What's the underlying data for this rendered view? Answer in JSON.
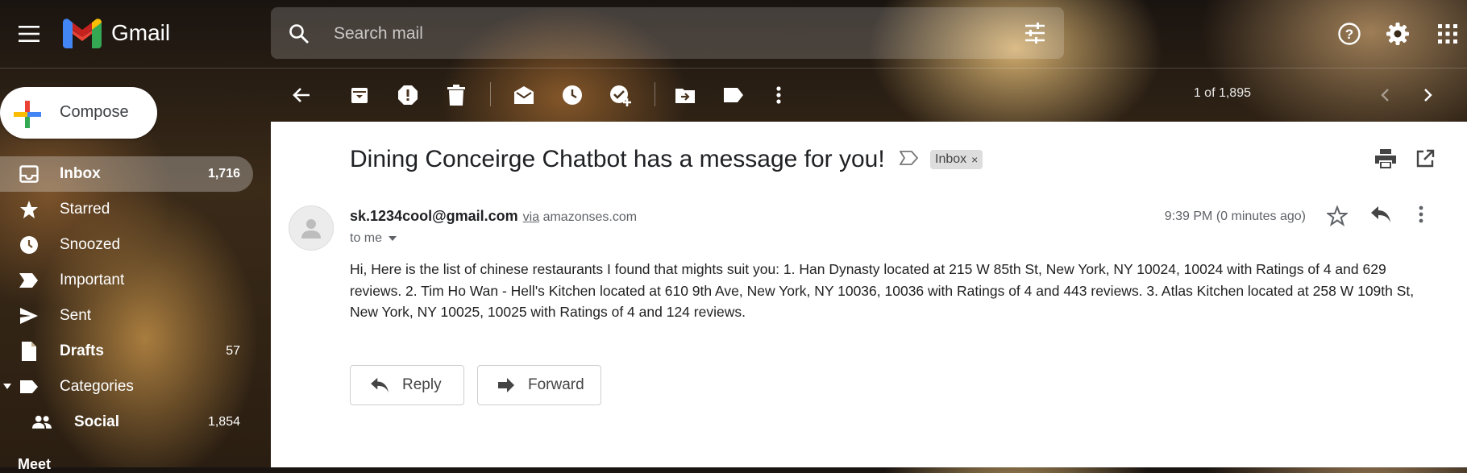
{
  "app": {
    "name": "Gmail"
  },
  "search": {
    "placeholder": "Search mail"
  },
  "sidebar": {
    "compose_label": "Compose",
    "items": [
      {
        "label": "Inbox",
        "count": "1,716"
      },
      {
        "label": "Starred",
        "count": ""
      },
      {
        "label": "Snoozed",
        "count": ""
      },
      {
        "label": "Important",
        "count": ""
      },
      {
        "label": "Sent",
        "count": ""
      },
      {
        "label": "Drafts",
        "count": "57"
      },
      {
        "label": "Categories",
        "count": ""
      },
      {
        "label": "Social",
        "count": "1,854"
      }
    ],
    "meet_label": "Meet"
  },
  "toolbar": {
    "pager": "1 of 1,895"
  },
  "email": {
    "subject": "Dining Conceirge Chatbot has a message for you!",
    "label_chip": "Inbox",
    "label_chip_close": "×",
    "sender_email": "sk.1234cool@gmail.com",
    "via_word": "via",
    "via_domain": "amazonses.com",
    "to": "to me",
    "time": "9:39 PM (0 minutes ago)",
    "body": "Hi, Here is the list of chinese restaurants I found that mights suit you: 1. Han Dynasty located at 215 W 85th St, New York, NY 10024, 10024 with Ratings of 4 and 629 reviews. 2. Tim Ho Wan - Hell's Kitchen located at 610 9th Ave, New York, NY 10036, 10036 with Ratings of 4 and 443 reviews. 3. Atlas Kitchen located at 258 W 109th St, New York, NY 10025, 10025 with Ratings of 4 and 124 reviews."
  },
  "actions": {
    "reply_label": "Reply",
    "forward_label": "Forward"
  },
  "icons": {
    "menu": "menu-icon",
    "search": "search-icon",
    "tune": "tune-icon",
    "help": "help-icon",
    "settings": "gear-icon",
    "apps": "apps-grid-icon",
    "back": "back-arrow-icon",
    "archive": "archive-icon",
    "spam": "report-spam-icon",
    "delete": "trash-icon",
    "mark_unread": "mark-unread-icon",
    "snooze": "snooze-icon",
    "add_task": "add-task-icon",
    "move": "move-to-icon",
    "label": "label-icon",
    "more": "more-vert-icon",
    "prev": "chevron-left-icon",
    "next": "chevron-right-icon"
  },
  "colors": {
    "accent_red": "#ea4335",
    "accent_blue": "#4285f4",
    "accent_green": "#34a853",
    "accent_yellow": "#fbbc04"
  }
}
